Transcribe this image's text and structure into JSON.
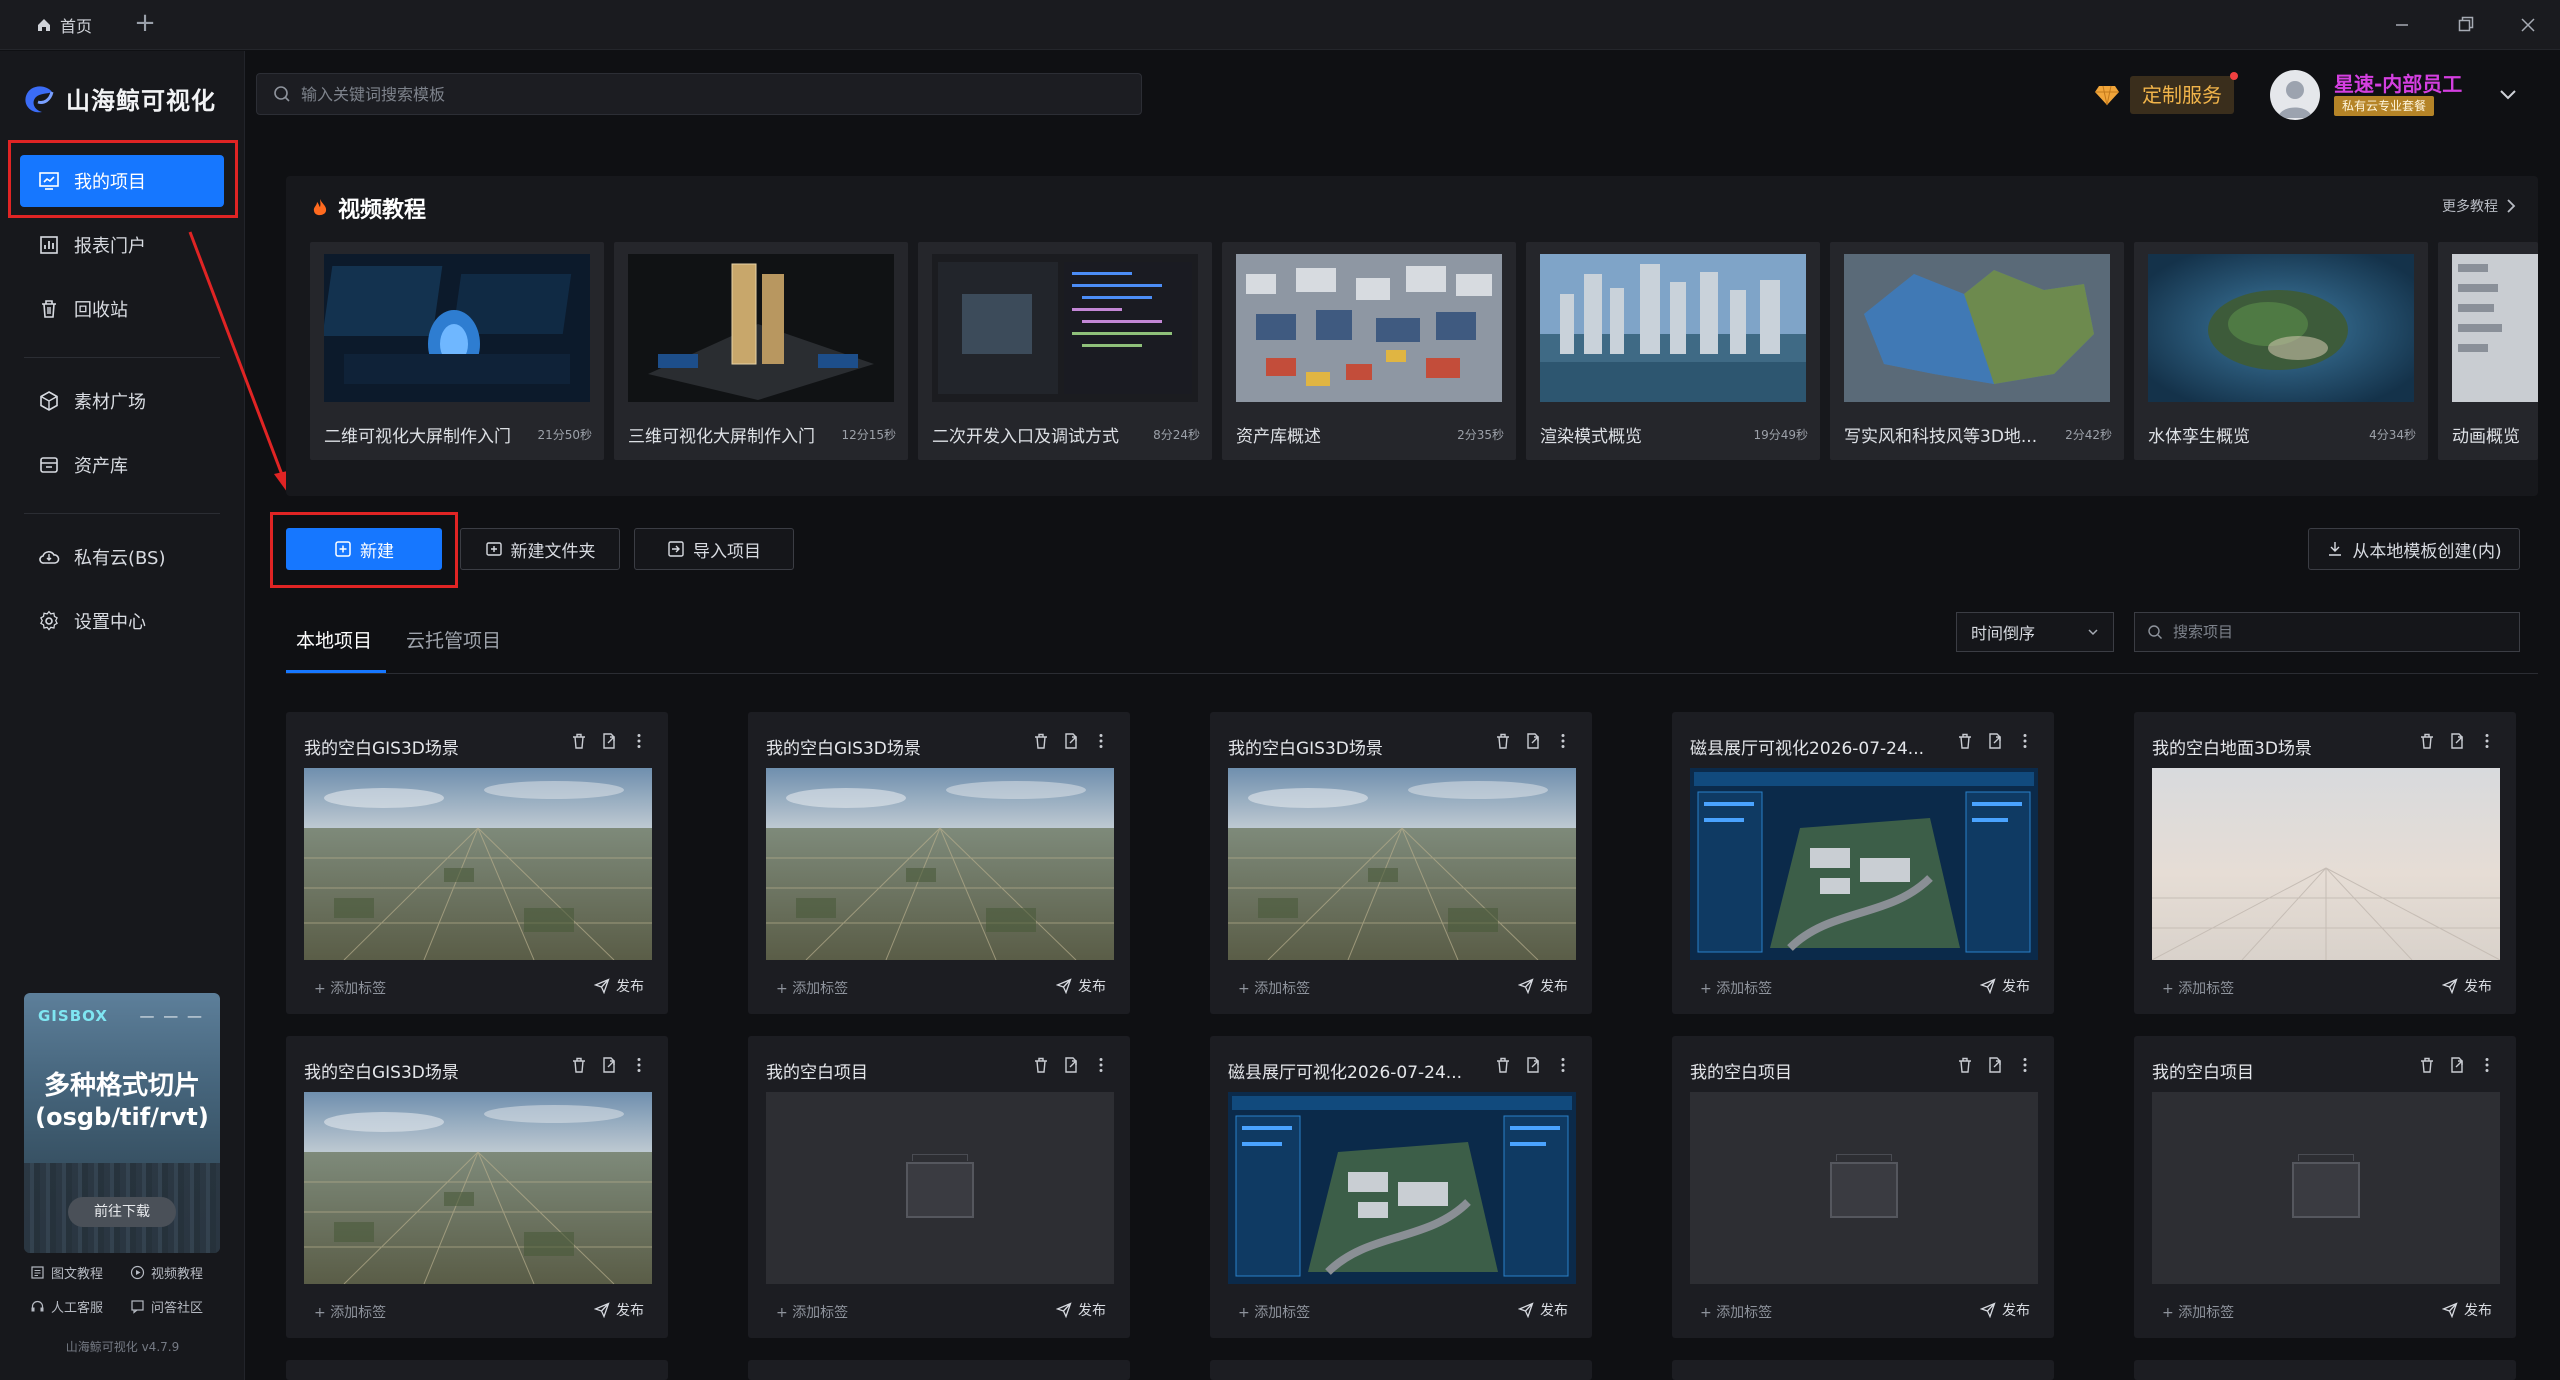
{
  "titlebar": {
    "home_tab": "首页",
    "add_tab": "+"
  },
  "app": {
    "name": "山海鲸可视化",
    "version": "山海鲸可视化 v4.7.9"
  },
  "sidebar": {
    "items": [
      {
        "label": "我的项目",
        "icon": "monitor-chart-icon",
        "active": true
      },
      {
        "label": "报表门户",
        "icon": "report-icon"
      },
      {
        "label": "回收站",
        "icon": "trash-icon"
      },
      {
        "label": "素材广场",
        "icon": "cube-icon"
      },
      {
        "label": "资产库",
        "icon": "asset-icon"
      },
      {
        "label": "私有云(BS)",
        "icon": "cloud-icon"
      },
      {
        "label": "设置中心",
        "icon": "gear-icon"
      }
    ],
    "promo": {
      "brand": "GISBOX",
      "dash": "— — —",
      "line1": "多种格式切片",
      "line2": "(osgb/tif/rvt)",
      "button": "前往下载"
    },
    "help": {
      "docs": "图文教程",
      "video": "视频教程",
      "support": "人工客服",
      "community": "问答社区"
    }
  },
  "top": {
    "search_placeholder": "输入关键词搜索模板",
    "custom_service": "定制服务",
    "user_name": "星速-内部员工",
    "user_badge": "私有云专业套餐"
  },
  "tutorials": {
    "title": "视频教程",
    "more": "更多教程",
    "items": [
      {
        "name": "二维可视化大屏制作入门",
        "duration": "21分50秒"
      },
      {
        "name": "三维可视化大屏制作入门",
        "duration": "12分15秒"
      },
      {
        "name": "二次开发入口及调试方式",
        "duration": "8分24秒"
      },
      {
        "name": "资产库概述",
        "duration": "2分35秒"
      },
      {
        "name": "渲染模式概览",
        "duration": "19分49秒"
      },
      {
        "name": "写实风和科技风等3D地...",
        "duration": "2分42秒"
      },
      {
        "name": "水体孪生概览",
        "duration": "4分34秒"
      },
      {
        "name": "动画概览",
        "duration": ""
      }
    ]
  },
  "actions": {
    "new": "新建",
    "new_folder": "新建文件夹",
    "import": "导入项目",
    "from_template": "从本地模板创建(内)"
  },
  "tabs": {
    "local": "本地项目",
    "cloud": "云托管项目"
  },
  "sort": {
    "selected": "时间倒序"
  },
  "search_projects_placeholder": "搜索项目",
  "card_labels": {
    "add_tag": "添加标签",
    "publish": "发布"
  },
  "projects": [
    {
      "title": "我的空白GIS3D场景",
      "thumb": "aerial"
    },
    {
      "title": "我的空白GIS3D场景",
      "thumb": "aerial"
    },
    {
      "title": "我的空白GIS3D场景",
      "thumb": "aerial"
    },
    {
      "title": "磁县展厅可视化2026-07-24...",
      "thumb": "dashboard"
    },
    {
      "title": "我的空白地面3D场景",
      "thumb": "ground"
    },
    {
      "title": "我的空白GIS3D场景",
      "thumb": "aerial"
    },
    {
      "title": "我的空白项目",
      "thumb": "empty"
    },
    {
      "title": "磁县展厅可视化2026-07-24...",
      "thumb": "dashboard"
    },
    {
      "title": "我的空白项目",
      "thumb": "empty"
    },
    {
      "title": "我的空白项目",
      "thumb": "empty"
    }
  ],
  "colors": {
    "accent": "#1677ff",
    "highlight_box": "#e02424",
    "service": "#f1b44a",
    "user_name": "#d43fe0"
  }
}
